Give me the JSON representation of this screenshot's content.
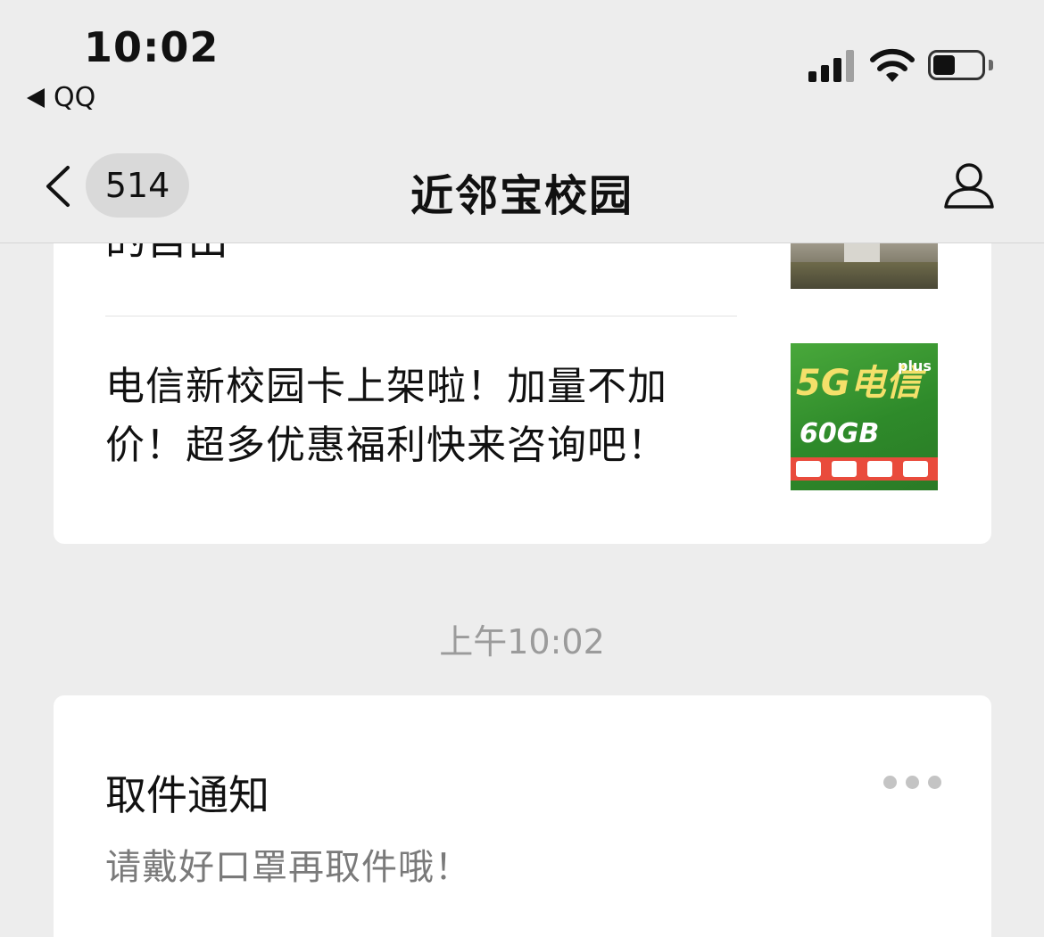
{
  "status_bar": {
    "time": "10:02",
    "back_app": "QQ",
    "icons": [
      "signal-icon",
      "wifi-icon",
      "battery-icon"
    ]
  },
  "nav": {
    "back_icon": "chevron-left-icon",
    "unread_count": "514",
    "title": "近邻宝校园",
    "profile_icon": "person-icon"
  },
  "messages": {
    "card1": {
      "partial_title": "的自由",
      "article_title": "电信新校园卡上架啦！加量不加价！超多优惠福利快来咨询吧！"
    },
    "timestamp": "上午10:02",
    "card2": {
      "title": "取件通知",
      "body": "请戴好口罩再取件哦！",
      "more_icon": "more-dots-icon"
    }
  },
  "colors": {
    "background": "#ededed",
    "card": "#ffffff",
    "muted_text": "#9b9b9b",
    "thumb_green": "#2e8a2a"
  }
}
